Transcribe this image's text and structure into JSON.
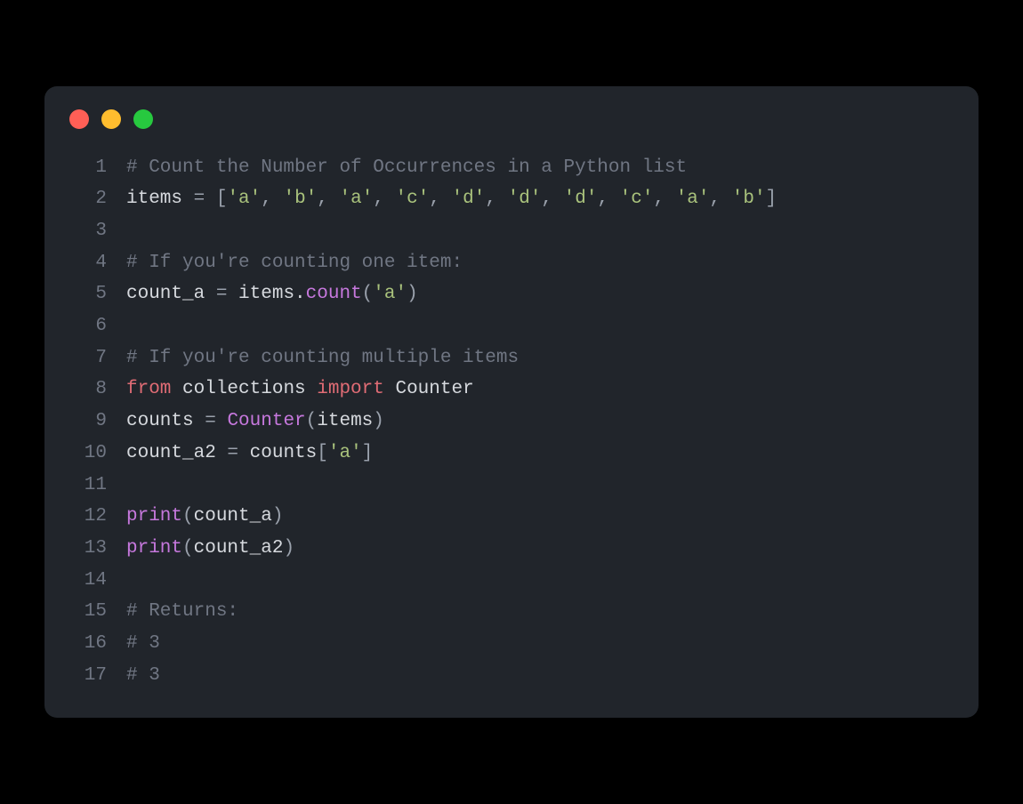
{
  "code": {
    "lines": [
      {
        "n": "1",
        "tokens": [
          {
            "t": "# Count the Number of Occurrences in a Python list",
            "c": "comment"
          }
        ]
      },
      {
        "n": "2",
        "tokens": [
          {
            "t": "items ",
            "c": "default"
          },
          {
            "t": "=",
            "c": "operator"
          },
          {
            "t": " ",
            "c": "default"
          },
          {
            "t": "[",
            "c": "punct"
          },
          {
            "t": "'a'",
            "c": "string"
          },
          {
            "t": ", ",
            "c": "punct"
          },
          {
            "t": "'b'",
            "c": "string"
          },
          {
            "t": ", ",
            "c": "punct"
          },
          {
            "t": "'a'",
            "c": "string"
          },
          {
            "t": ", ",
            "c": "punct"
          },
          {
            "t": "'c'",
            "c": "string"
          },
          {
            "t": ", ",
            "c": "punct"
          },
          {
            "t": "'d'",
            "c": "string"
          },
          {
            "t": ", ",
            "c": "punct"
          },
          {
            "t": "'d'",
            "c": "string"
          },
          {
            "t": ", ",
            "c": "punct"
          },
          {
            "t": "'d'",
            "c": "string"
          },
          {
            "t": ", ",
            "c": "punct"
          },
          {
            "t": "'c'",
            "c": "string"
          },
          {
            "t": ", ",
            "c": "punct"
          },
          {
            "t": "'a'",
            "c": "string"
          },
          {
            "t": ", ",
            "c": "punct"
          },
          {
            "t": "'b'",
            "c": "string"
          },
          {
            "t": "]",
            "c": "punct"
          }
        ]
      },
      {
        "n": "3",
        "tokens": []
      },
      {
        "n": "4",
        "tokens": [
          {
            "t": "# If you're counting one item:",
            "c": "comment"
          }
        ]
      },
      {
        "n": "5",
        "tokens": [
          {
            "t": "count_a ",
            "c": "default"
          },
          {
            "t": "=",
            "c": "operator"
          },
          {
            "t": " items.",
            "c": "default"
          },
          {
            "t": "count",
            "c": "func"
          },
          {
            "t": "(",
            "c": "punct"
          },
          {
            "t": "'a'",
            "c": "string"
          },
          {
            "t": ")",
            "c": "punct"
          }
        ]
      },
      {
        "n": "6",
        "tokens": []
      },
      {
        "n": "7",
        "tokens": [
          {
            "t": "# If you're counting multiple items",
            "c": "comment"
          }
        ]
      },
      {
        "n": "8",
        "tokens": [
          {
            "t": "from",
            "c": "keyword"
          },
          {
            "t": " collections ",
            "c": "default"
          },
          {
            "t": "import",
            "c": "keyword"
          },
          {
            "t": " Counter",
            "c": "default"
          }
        ]
      },
      {
        "n": "9",
        "tokens": [
          {
            "t": "counts ",
            "c": "default"
          },
          {
            "t": "=",
            "c": "operator"
          },
          {
            "t": " ",
            "c": "default"
          },
          {
            "t": "Counter",
            "c": "func"
          },
          {
            "t": "(",
            "c": "punct"
          },
          {
            "t": "items",
            "c": "default"
          },
          {
            "t": ")",
            "c": "punct"
          }
        ]
      },
      {
        "n": "10",
        "tokens": [
          {
            "t": "count_a2 ",
            "c": "default"
          },
          {
            "t": "=",
            "c": "operator"
          },
          {
            "t": " counts",
            "c": "default"
          },
          {
            "t": "[",
            "c": "punct"
          },
          {
            "t": "'a'",
            "c": "string"
          },
          {
            "t": "]",
            "c": "punct"
          }
        ]
      },
      {
        "n": "11",
        "tokens": []
      },
      {
        "n": "12",
        "tokens": [
          {
            "t": "print",
            "c": "func"
          },
          {
            "t": "(",
            "c": "punct"
          },
          {
            "t": "count_a",
            "c": "default"
          },
          {
            "t": ")",
            "c": "punct"
          }
        ]
      },
      {
        "n": "13",
        "tokens": [
          {
            "t": "print",
            "c": "func"
          },
          {
            "t": "(",
            "c": "punct"
          },
          {
            "t": "count_a2",
            "c": "default"
          },
          {
            "t": ")",
            "c": "punct"
          }
        ]
      },
      {
        "n": "14",
        "tokens": []
      },
      {
        "n": "15",
        "tokens": [
          {
            "t": "# Returns:",
            "c": "comment"
          }
        ]
      },
      {
        "n": "16",
        "tokens": [
          {
            "t": "# 3",
            "c": "comment"
          }
        ]
      },
      {
        "n": "17",
        "tokens": [
          {
            "t": "# 3",
            "c": "comment"
          }
        ]
      }
    ]
  },
  "window": {
    "controls": [
      "close",
      "minimize",
      "zoom"
    ]
  },
  "colors": {
    "background": "#21252b",
    "comment": "#707683",
    "default": "#d6d9de",
    "operator": "#9aa1ac",
    "punct": "#9aa1ac",
    "string": "#a9c27c",
    "func": "#c678dd",
    "keyword": "#e06c75"
  }
}
